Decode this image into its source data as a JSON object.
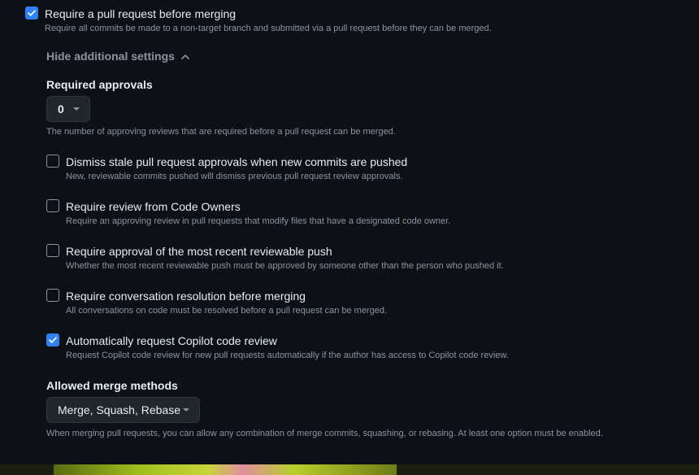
{
  "main_setting": {
    "checked": true,
    "label": "Require a pull request before merging",
    "description": "Require all commits be made to a non-target branch and submitted via a pull request before they can be merged."
  },
  "toggle": {
    "label": "Hide additional settings"
  },
  "required_approvals": {
    "heading": "Required approvals",
    "value": "0",
    "description": "The number of approving reviews that are required before a pull request can be merged."
  },
  "options": [
    {
      "checked": false,
      "label": "Dismiss stale pull request approvals when new commits are pushed",
      "description": "New, reviewable commits pushed will dismiss previous pull request review approvals."
    },
    {
      "checked": false,
      "label": "Require review from Code Owners",
      "description": "Require an approving review in pull requests that modify files that have a designated code owner."
    },
    {
      "checked": false,
      "label": "Require approval of the most recent reviewable push",
      "description": "Whether the most recent reviewable push must be approved by someone other than the person who pushed it."
    },
    {
      "checked": false,
      "label": "Require conversation resolution before merging",
      "description": "All conversations on code must be resolved before a pull request can be merged."
    },
    {
      "checked": true,
      "label": "Automatically request Copilot code review",
      "description": "Request Copilot code review for new pull requests automatically if the author has access to Copilot code review."
    }
  ],
  "merge_methods": {
    "heading": "Allowed merge methods",
    "value": "Merge, Squash, Rebase",
    "description": "When merging pull requests, you can allow any combination of merge commits, squashing, or rebasing. At least one option must be enabled."
  },
  "colors": {
    "background": "#0d1117",
    "accent": "#2f81f7",
    "text": "#e6edf3",
    "muted": "#8b949e"
  }
}
